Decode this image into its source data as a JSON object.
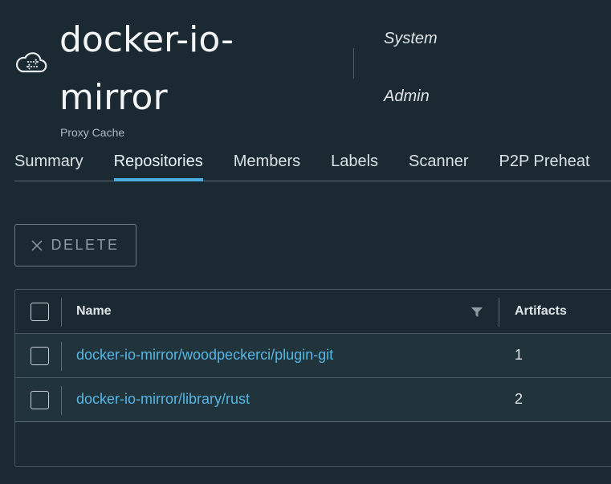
{
  "project": {
    "title": "docker-io-mirror",
    "subtitle": "Proxy Cache",
    "icon": "cloud-sync-icon",
    "roles": [
      "System",
      "Admin"
    ]
  },
  "tabs": [
    {
      "label": "Summary",
      "active": false
    },
    {
      "label": "Repositories",
      "active": true
    },
    {
      "label": "Members",
      "active": false
    },
    {
      "label": "Labels",
      "active": false
    },
    {
      "label": "Scanner",
      "active": false
    },
    {
      "label": "P2P Preheat",
      "active": false
    }
  ],
  "toolbar": {
    "delete_label": "DELETE",
    "delete_icon": "close-icon"
  },
  "table": {
    "columns": {
      "name": "Name",
      "artifacts": "Artifacts"
    },
    "rows": [
      {
        "name": "docker-io-mirror/woodpeckerci/plugin-git",
        "artifacts": "1"
      },
      {
        "name": "docker-io-mirror/library/rust",
        "artifacts": "2"
      }
    ]
  },
  "colors": {
    "background": "#1b2a32",
    "accent": "#4aaee0",
    "link": "#57b6e5"
  }
}
